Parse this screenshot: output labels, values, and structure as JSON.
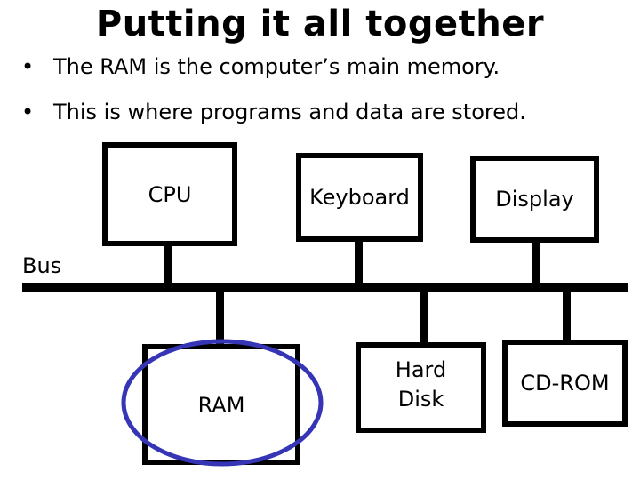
{
  "slide": {
    "title": "Putting it all together",
    "bullets": [
      {
        "marker": "•",
        "text": "The RAM is the computer’s main memory."
      },
      {
        "marker": "•",
        "text": "This is where programs and data are stored."
      }
    ]
  },
  "diagram": {
    "bus_label": "Bus",
    "top_components": [
      {
        "label": "CPU"
      },
      {
        "label": "Keyboard"
      },
      {
        "label": "Display"
      }
    ],
    "bottom_components": [
      {
        "label": "RAM"
      },
      {
        "label": "Hard\nDisk",
        "line1": "Hard",
        "line2": "Disk"
      },
      {
        "label": "CD-ROM"
      }
    ],
    "highlight": {
      "target": "RAM",
      "shape": "ellipse",
      "color": "#3535b5"
    }
  }
}
